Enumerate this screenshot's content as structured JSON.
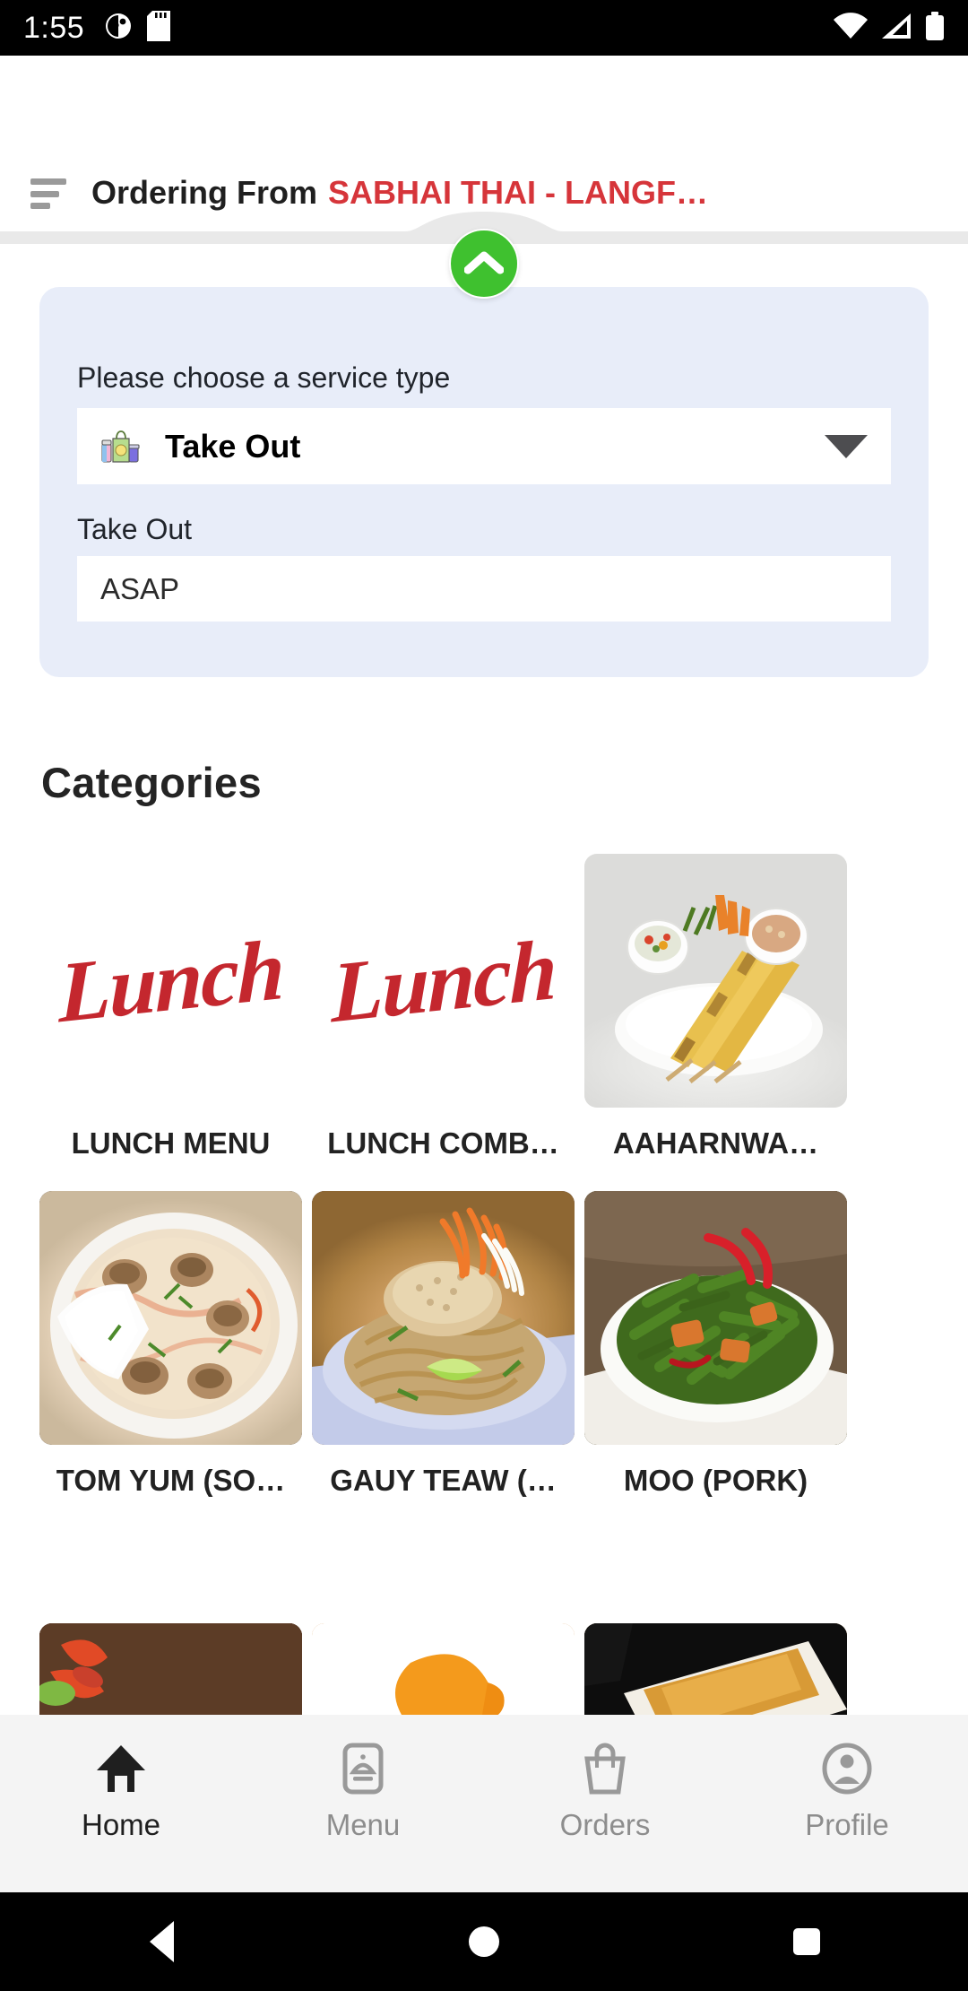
{
  "status_bar": {
    "time": "1:55",
    "icons_left": [
      "notification-dot-icon",
      "sd-card-icon"
    ],
    "icons_right": [
      "wifi-icon",
      "cellular-signal-icon",
      "battery-icon"
    ]
  },
  "app_bar": {
    "menu_icon": "hamburger-menu-icon",
    "prefix": "Ordering From",
    "restaurant": "SABHAI THAI - LANGF…",
    "restaurant_color": "#d6353a"
  },
  "collapse_button": {
    "icon": "chevron-up-icon",
    "color": "#3fc12f"
  },
  "service_card": {
    "background": "#e8edf9",
    "service_type_label": "Please choose a service type",
    "service_type_value": "Take Out",
    "service_type_icon": "shopping-bag-icon",
    "dropdown_icon": "caret-down-icon",
    "time_slot_label": "Take Out",
    "time_slot_value": "ASAP"
  },
  "categories": {
    "heading": "Categories",
    "items": [
      {
        "label": "LUNCH MENU",
        "thumb": "lunch-script-logo",
        "logo_text": "Lunch"
      },
      {
        "label": "LUNCH COMB…",
        "thumb": "lunch-script-logo",
        "logo_text": "Lunch"
      },
      {
        "label": "AAHARNWA…",
        "thumb": "chicken-satay-photo"
      },
      {
        "label": "TOM YUM (SO…",
        "thumb": "tom-yum-soup-photo"
      },
      {
        "label": "GAUY TEAW (…",
        "thumb": "pad-thai-noodles-photo"
      },
      {
        "label": "MOO (PORK)",
        "thumb": "pork-green-bean-photo"
      }
    ],
    "partial_row": [
      {
        "thumb": "shrimp-dish-photo"
      },
      {
        "thumb": "yellow-curry-photo"
      },
      {
        "thumb": "dark-plate-dish-photo"
      }
    ]
  },
  "bottom_nav": {
    "active": "Home",
    "items": [
      {
        "label": "Home",
        "icon": "home-icon"
      },
      {
        "label": "Menu",
        "icon": "menu-cloche-icon"
      },
      {
        "label": "Orders",
        "icon": "shopping-bag-icon"
      },
      {
        "label": "Profile",
        "icon": "person-circle-icon"
      }
    ]
  },
  "system_nav": {
    "back": "back-triangle-icon",
    "home": "home-circle-icon",
    "recents": "recents-square-icon"
  }
}
